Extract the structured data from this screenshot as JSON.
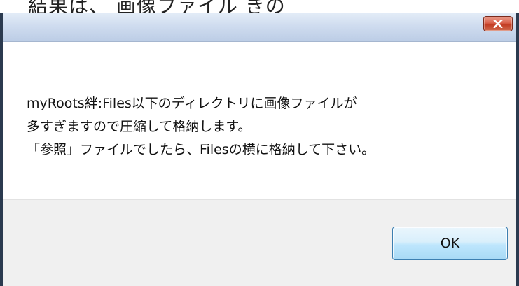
{
  "background": {
    "partial_text": "結果は、                  画像ファイル     きの"
  },
  "dialog": {
    "close_symbol": "✕",
    "message_lines": [
      "myRoots絆:Files以下のディレクトリに画像ファイルが",
      "多すぎますので圧縮して格納します。",
      "「参照」ファイルでしたら、Filesの横に格納して下さい。"
    ],
    "ok_label": "OK"
  },
  "colors": {
    "titlebar": "#cfdcef",
    "close_button": "#c23b22",
    "footer": "#f0f0f0",
    "ok_border": "#3c7fb1",
    "frame": "#2b3a4f"
  },
  "icons": {
    "close": "close-icon"
  }
}
